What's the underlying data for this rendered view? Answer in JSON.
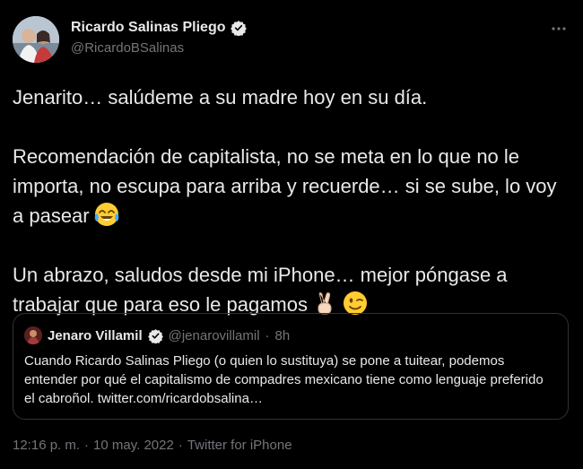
{
  "tweet": {
    "author": {
      "display_name": "Ricardo Salinas Pliego",
      "handle": "@RicardoBSalinas"
    },
    "more_icon": "more-horizontal-icon",
    "paragraphs": {
      "p1": "Jenarito… salúdeme a su madre hoy en su día.",
      "p2": "Recomendación de capitalista, no se meta en lo que no le importa, no escupa para arriba y recuerde… si se sube, lo voy a pasear",
      "p3": "Un abrazo, saludos desde mi iPhone… mejor póngase a trabajar que para eso le pagamos"
    },
    "emojis": {
      "laughing": "face-with-tears-of-joy",
      "victory": "victory-hand",
      "wink": "winking-face"
    },
    "quote": {
      "display_name": "Jenaro Villamil",
      "handle": "@jenarovillamil",
      "separator": "·",
      "time": "8h",
      "text": "Cuando Ricardo Salinas Pliego (o quien lo sustituya) se pone a tuitear, podemos entender por qué el capitalismo de compadres mexicano tiene como lenguaje preferido el cabroñol. twitter.com/ricardobsalina…"
    },
    "meta": {
      "time": "12:16 p. m.",
      "separator1": "·",
      "date": "10 may. 2022",
      "separator2": "·",
      "source": "Twitter for iPhone"
    }
  },
  "colors": {
    "background": "#000000",
    "text": "#e7e9ea",
    "secondary": "#71767b",
    "verified": "#e7e9ea",
    "border": "#2f3336"
  }
}
